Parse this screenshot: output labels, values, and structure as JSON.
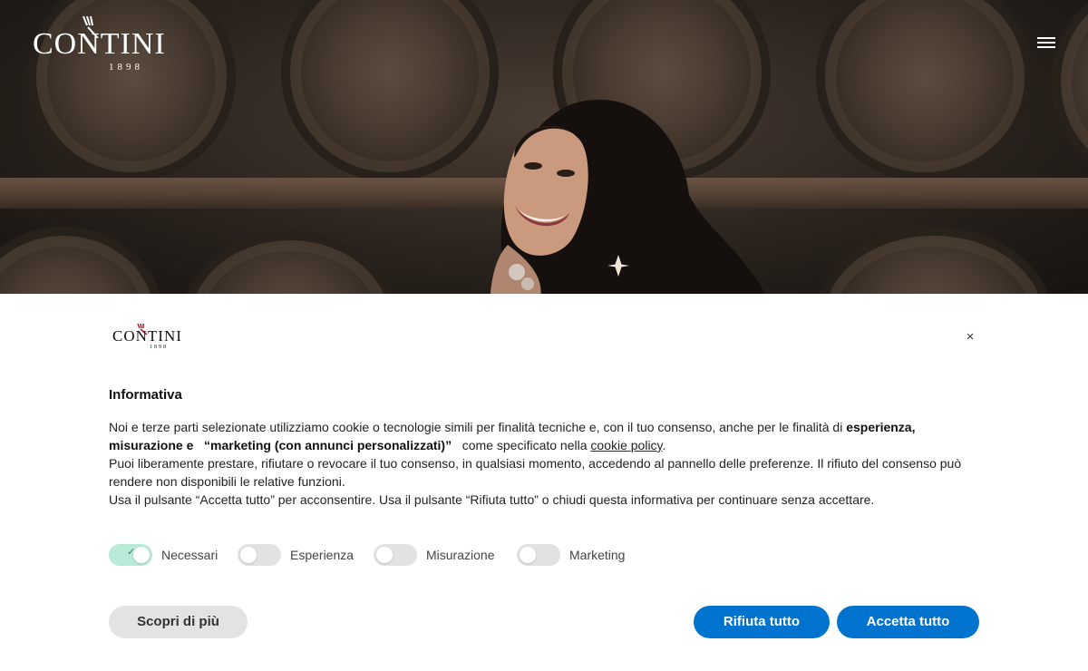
{
  "header": {
    "brand": "CONTINI",
    "year": "1898"
  },
  "banner": {
    "brand": "CONTINI",
    "year": "1898",
    "close_symbol": "×",
    "title": "Informativa",
    "text": {
      "p1_part1": "Noi e terze parti selezionate utilizziamo cookie o tecnologie simili per finalità tecniche e, con il tuo consenso, anche per le finalità di ",
      "p1_bold1": "esperienza, misurazione e",
      "p1_bold2": "“marketing (con annunci personalizzati)”",
      "p1_part2": " come specificato nella ",
      "p1_link": "cookie policy",
      "p1_end": ".",
      "p2": "Puoi liberamente prestare, rifiutare o revocare il tuo consenso, in qualsiasi momento, accedendo al pannello delle preferenze. Il rifiuto del consenso può rendere non disponibili le relative funzioni.",
      "p3": "Usa il pulsante “Accetta tutto” per acconsentire. Usa il pulsante “Rifiuta tutto” o chiudi questa informativa per continuare senza accettare."
    },
    "toggles": [
      {
        "label": "Necessari",
        "on": true
      },
      {
        "label": "Esperienza",
        "on": false
      },
      {
        "label": "Misurazione",
        "on": false
      },
      {
        "label": "Marketing",
        "on": false
      }
    ],
    "buttons": {
      "more": "Scopri di più",
      "reject": "Rifiuta tutto",
      "accept": "Accetta tutto"
    },
    "colors": {
      "primary": "#0073ce",
      "toggle_on": "#b8ead8",
      "toggle_off": "#e2e2e2"
    }
  }
}
